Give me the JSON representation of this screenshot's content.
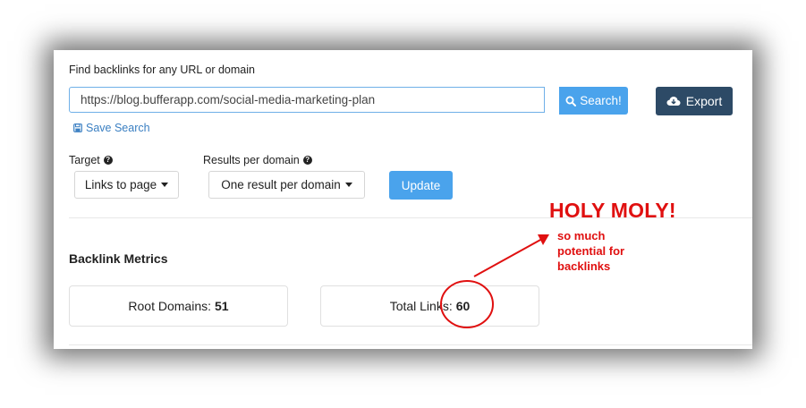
{
  "search": {
    "label": "Find backlinks for any URL or domain",
    "url_value": "https://blog.bufferapp.com/social-media-marketing-plan",
    "search_label": "Search!",
    "save_label": "Save Search"
  },
  "export": {
    "label": "Export"
  },
  "filters": {
    "target_label": "Target",
    "target_value": "Links to page",
    "results_label": "Results per domain",
    "results_value": "One result per domain",
    "update_label": "Update"
  },
  "metrics": {
    "title": "Backlink Metrics",
    "root_domains_label": "Root Domains:",
    "root_domains_value": "51",
    "total_links_label": "Total Links:",
    "total_links_value": "60"
  },
  "annotation": {
    "headline": "HOLY MOLY!",
    "note": "so much\npotential for\nbacklinks",
    "color": "#e01010"
  },
  "colors": {
    "search_button": "#4aa3ec",
    "export_button": "#2d4a66",
    "link": "#3a7fc2"
  }
}
